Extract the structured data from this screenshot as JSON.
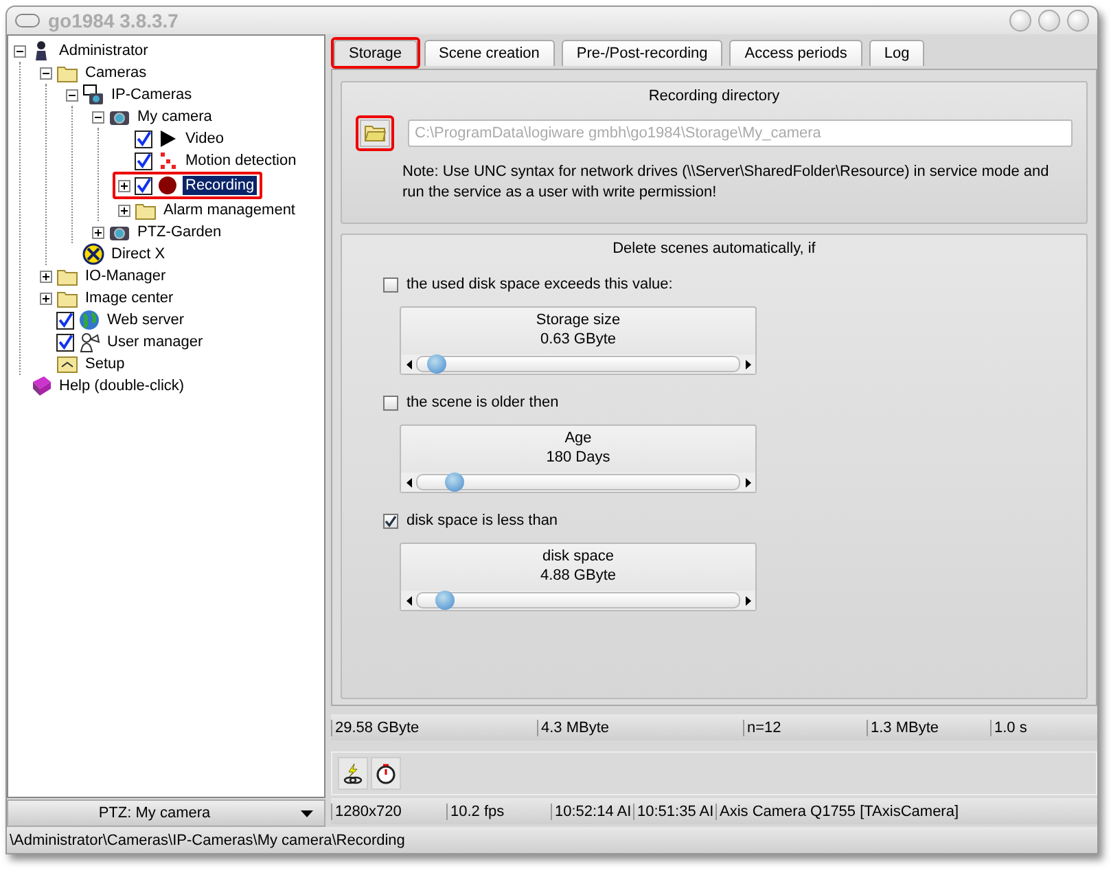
{
  "window": {
    "title": "go1984 3.8.3.7"
  },
  "tree": [
    {
      "label": "Administrator",
      "kind": "user",
      "expanded": true,
      "selected": false,
      "children": [
        {
          "label": "Cameras",
          "kind": "folder",
          "expanded": true,
          "selected": false,
          "children": [
            {
              "label": "IP-Cameras",
              "kind": "ipcams",
              "expanded": true,
              "selected": false,
              "children": [
                {
                  "label": "My camera",
                  "kind": "camera",
                  "expanded": true,
                  "selected": false,
                  "children": [
                    {
                      "label": "Video",
                      "kind": "play",
                      "checked": true,
                      "selected": false
                    },
                    {
                      "label": "Motion detection",
                      "kind": "motion",
                      "checked": true,
                      "selected": false
                    },
                    {
                      "label": "Recording",
                      "kind": "record",
                      "expanded": false,
                      "checked": true,
                      "selected": true,
                      "highlighted": true
                    },
                    {
                      "label": "Alarm management",
                      "kind": "folder",
                      "expanded": false,
                      "selected": false
                    }
                  ]
                },
                {
                  "label": "PTZ-Garden",
                  "kind": "camera",
                  "expanded": false,
                  "selected": false
                }
              ]
            },
            {
              "label": "Direct X",
              "kind": "directx",
              "selected": false
            }
          ]
        },
        {
          "label": "IO-Manager",
          "kind": "folder",
          "expanded": false,
          "selected": false
        },
        {
          "label": "Image center",
          "kind": "folder",
          "expanded": false,
          "selected": false
        },
        {
          "label": "Web server",
          "kind": "globe",
          "checked": true,
          "selected": false
        },
        {
          "label": "User manager",
          "kind": "users",
          "checked": true,
          "selected": false
        },
        {
          "label": "Setup",
          "kind": "setup",
          "selected": false
        }
      ]
    },
    {
      "label": "Help (double-click)",
      "kind": "book",
      "selected": false
    }
  ],
  "ptz_selector": {
    "value": "PTZ: My camera"
  },
  "tabs": [
    {
      "label": "Storage",
      "selected": true,
      "highlighted": true
    },
    {
      "label": "Scene creation",
      "selected": false
    },
    {
      "label": "Pre-/Post-recording",
      "selected": false
    },
    {
      "label": "Access periods",
      "selected": false
    },
    {
      "label": "Log",
      "selected": false
    }
  ],
  "recording_directory": {
    "title": "Recording directory",
    "browse_highlighted": true,
    "path": "C:\\ProgramData\\logiware gmbh\\go1984\\Storage\\My_camera",
    "note": "Note: Use UNC syntax for network drives (\\\\Server\\SharedFolder\\Resource) in service mode and run the service as a user with write permission!"
  },
  "delete_scenes": {
    "title": "Delete scenes automatically, if",
    "conditions": [
      {
        "label": "the used disk space exceeds this value:",
        "checked": false,
        "slider_title": "Storage size",
        "reading": "0.63 GByte",
        "level": 0.03
      },
      {
        "label": "the scene is older then",
        "checked": false,
        "slider_title": "Age",
        "reading": "180 Days",
        "level": 0.09
      },
      {
        "label": "disk space is less than",
        "checked": true,
        "slider_title": "disk space",
        "reading": "4.88 GByte",
        "level": 0.06
      }
    ]
  },
  "stats_bar": [
    "29.58 GByte",
    "4.3 MByte",
    "n=12",
    "1.3 MByte",
    "1.0 s"
  ],
  "toolbar": [
    {
      "kind": "lightning"
    },
    {
      "kind": "stopwatch"
    }
  ],
  "info_bar": [
    "1280x720",
    "10.2 fps",
    "10:52:14 AI",
    "10:51:35 AI",
    "Axis Camera Q1755 [TAxisCamera]"
  ],
  "path_bar": "\\Administrator\\Cameras\\IP-Cameras\\My camera\\Recording"
}
